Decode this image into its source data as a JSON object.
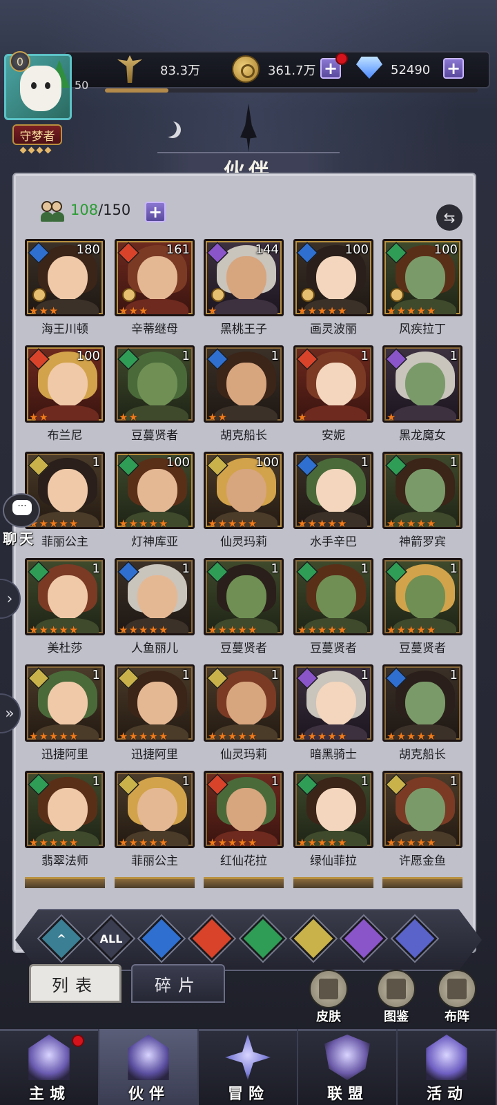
{
  "player": {
    "rank": "0",
    "level": "50",
    "title": "守梦者",
    "xp_fraction": 0.17
  },
  "resources": {
    "power": {
      "value": "83.3万",
      "icon": "sword-power-icon"
    },
    "gold": {
      "value": "361.7万",
      "icon": "gold-coin-icon"
    },
    "gems": {
      "value": "52490",
      "icon": "diamond-icon"
    }
  },
  "page": {
    "title": "伙伴"
  },
  "roster": {
    "owned": "108",
    "capacity": "/150"
  },
  "chat": {
    "label": "聊天"
  },
  "colors": {
    "fire": "#d8432a",
    "water": "#2f6fd0",
    "wind": "#2f9d55",
    "light": "#c9b24a",
    "dark": "#8a55c9",
    "star": "#f07a1a",
    "owned_count": "#2a9c33"
  },
  "heroes": [
    {
      "name": "海王川顿",
      "level": "180",
      "element": "water",
      "stars": 3,
      "rank_badge": true
    },
    {
      "name": "辛蒂继母",
      "level": "161",
      "element": "fire",
      "stars": 3,
      "rank_badge": true
    },
    {
      "name": "黑桃王子",
      "level": "144",
      "element": "dark",
      "stars": 1,
      "rank_badge": true
    },
    {
      "name": "画灵波丽",
      "level": "100",
      "element": "water",
      "stars": 5,
      "rank_badge": true
    },
    {
      "name": "风疾拉丁",
      "level": "100",
      "element": "wind",
      "stars": 5,
      "rank_badge": true
    },
    {
      "name": "布兰尼",
      "level": "100",
      "element": "fire",
      "stars": 2,
      "rank_badge": false
    },
    {
      "name": "豆蔓贤者",
      "level": "1",
      "element": "wind",
      "stars": 2,
      "rank_badge": false
    },
    {
      "name": "胡克船长",
      "level": "1",
      "element": "water",
      "stars": 2,
      "rank_badge": false
    },
    {
      "name": "安妮",
      "level": "1",
      "element": "fire",
      "stars": 1,
      "rank_badge": false
    },
    {
      "name": "黑龙魔女",
      "level": "1",
      "element": "dark",
      "stars": 1,
      "rank_badge": false
    },
    {
      "name": "菲丽公主",
      "level": "1",
      "element": "light",
      "stars": 5,
      "rank_badge": false
    },
    {
      "name": "灯神库亚",
      "level": "100",
      "element": "wind",
      "stars": 5,
      "rank_badge": false
    },
    {
      "name": "仙灵玛莉",
      "level": "100",
      "element": "light",
      "stars": 5,
      "rank_badge": false
    },
    {
      "name": "水手辛巴",
      "level": "1",
      "element": "water",
      "stars": 5,
      "rank_badge": false
    },
    {
      "name": "神箭罗宾",
      "level": "1",
      "element": "wind",
      "stars": 5,
      "rank_badge": false
    },
    {
      "name": "美杜莎",
      "level": "1",
      "element": "wind",
      "stars": 5,
      "rank_badge": false
    },
    {
      "name": "人鱼丽儿",
      "level": "1",
      "element": "water",
      "stars": 5,
      "rank_badge": false
    },
    {
      "name": "豆蔓贤者",
      "level": "1",
      "element": "wind",
      "stars": 5,
      "rank_badge": false
    },
    {
      "name": "豆蔓贤者",
      "level": "1",
      "element": "wind",
      "stars": 5,
      "rank_badge": false
    },
    {
      "name": "豆蔓贤者",
      "level": "1",
      "element": "wind",
      "stars": 5,
      "rank_badge": false
    },
    {
      "name": "迅捷阿里",
      "level": "1",
      "element": "light",
      "stars": 5,
      "rank_badge": false
    },
    {
      "name": "迅捷阿里",
      "level": "1",
      "element": "light",
      "stars": 5,
      "rank_badge": false
    },
    {
      "name": "仙灵玛莉",
      "level": "1",
      "element": "light",
      "stars": 5,
      "rank_badge": false
    },
    {
      "name": "暗黑骑士",
      "level": "1",
      "element": "dark",
      "stars": 5,
      "rank_badge": false
    },
    {
      "name": "胡克船长",
      "level": "1",
      "element": "water",
      "stars": 5,
      "rank_badge": false
    },
    {
      "name": "翡翠法师",
      "level": "1",
      "element": "wind",
      "stars": 5,
      "rank_badge": false
    },
    {
      "name": "菲丽公主",
      "level": "1",
      "element": "light",
      "stars": 5,
      "rank_badge": false
    },
    {
      "name": "红仙花拉",
      "level": "1",
      "element": "fire",
      "stars": 5,
      "rank_badge": false
    },
    {
      "name": "绿仙菲拉",
      "level": "1",
      "element": "wind",
      "stars": 5,
      "rank_badge": false
    },
    {
      "name": "许愿金鱼",
      "level": "1",
      "element": "light",
      "stars": 5,
      "rank_badge": false
    }
  ],
  "filters": [
    {
      "key": "faction",
      "glyph": "^",
      "icon": "faction-filter-icon"
    },
    {
      "key": "all",
      "glyph": "ALL",
      "icon": "all-filter-icon"
    },
    {
      "key": "water",
      "glyph": "",
      "icon": "water-element-icon"
    },
    {
      "key": "fire",
      "glyph": "",
      "icon": "fire-element-icon"
    },
    {
      "key": "wind",
      "glyph": "",
      "icon": "wind-element-icon"
    },
    {
      "key": "light",
      "glyph": "",
      "icon": "light-element-icon"
    },
    {
      "key": "dark",
      "glyph": "",
      "icon": "dark-element-icon"
    },
    {
      "key": "cosmic",
      "glyph": "",
      "icon": "cosmic-element-icon"
    }
  ],
  "tabs": {
    "list": "列表",
    "fragments": "碎片"
  },
  "side_buttons": {
    "skin": "皮肤",
    "codex": "图鉴",
    "formation": "布阵"
  },
  "nav": [
    {
      "label": "主城",
      "icon": "castle-icon",
      "badge": true
    },
    {
      "label": "伙伴",
      "icon": "companion-hat-icon",
      "badge": false
    },
    {
      "label": "冒险",
      "icon": "adventure-compass-icon",
      "badge": false
    },
    {
      "label": "联盟",
      "icon": "alliance-shield-icon",
      "badge": false
    },
    {
      "label": "活动",
      "icon": "event-cards-icon",
      "badge": false
    }
  ]
}
